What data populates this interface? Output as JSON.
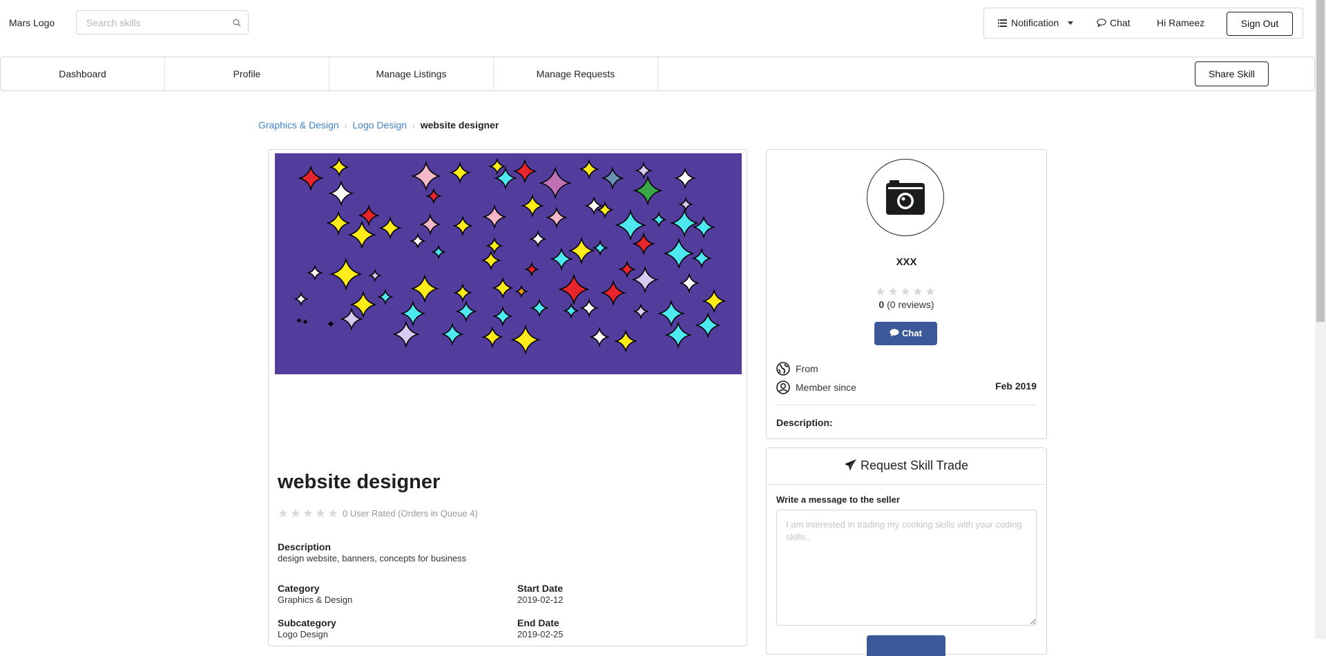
{
  "header": {
    "logo": "Mars Logo",
    "search_placeholder": "Search skills",
    "notification_label": "Notification",
    "chat_label": "Chat",
    "greeting": "Hi Rameez",
    "signout_label": "Sign Out"
  },
  "nav": {
    "items": [
      {
        "label": "Dashboard"
      },
      {
        "label": "Profile"
      },
      {
        "label": "Manage Listings"
      },
      {
        "label": "Manage Requests"
      }
    ],
    "share_label": "Share Skill"
  },
  "breadcrumb": {
    "items": [
      "Graphics & Design",
      "Logo Design"
    ],
    "current": "website designer"
  },
  "skill": {
    "title": "website designer",
    "rating_text": "0 User Rated (Orders in Queue 4)",
    "description_label": "Description",
    "description": "design website, banners, concepts for business",
    "category_label": "Category",
    "category": "Graphics & Design",
    "subcategory_label": "Subcategory",
    "subcategory": "Logo Design",
    "start_date_label": "Start Date",
    "start_date": "2019-02-12",
    "end_date_label": "End Date",
    "end_date": "2019-02-25",
    "image_background": "#533d9c"
  },
  "seller": {
    "name": "XXX",
    "rating_value": "0",
    "reviews_text": "(0 reviews)",
    "chat_label": "Chat",
    "from_label": "From",
    "member_since_label": "Member since",
    "member_since": "Feb 2019",
    "description_label": "Description:"
  },
  "trade": {
    "title": "Request Skill Trade",
    "message_label": "Write a message to the seller",
    "message_placeholder": "I am interested in trading my cooking skills with your coding skills.."
  },
  "colors": {
    "primary_button": "#3b5998",
    "link": "#4183c4",
    "border": "#d4d4d5"
  }
}
